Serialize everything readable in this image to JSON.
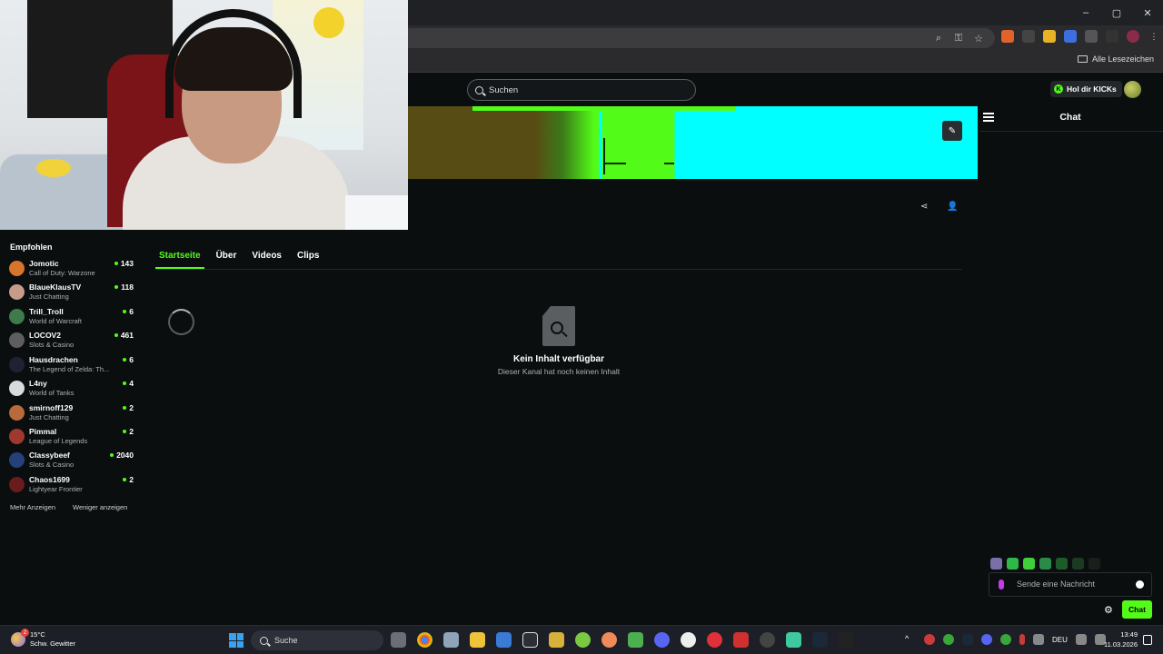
{
  "browser": {
    "window_controls": {
      "minimize": "–",
      "maximize": "▢",
      "close": "✕"
    },
    "bookmarks": {
      "all_label": "Alle Lesezeichen"
    }
  },
  "header": {
    "search_placeholder": "Suchen",
    "kicks_button": "Hol dir KICKs"
  },
  "chat": {
    "title": "Chat",
    "input_placeholder": "Sende eine Nachricht",
    "send_button": "Chat"
  },
  "sidebar": {
    "title": "Empfohlen",
    "items": [
      {
        "name": "Jomotic",
        "category": "Call of Duty: Warzone",
        "viewers": "143",
        "avatar_color": "#d8742b"
      },
      {
        "name": "BlaueKlausTV",
        "category": "Just Chatting",
        "viewers": "118",
        "avatar_color": "#c79b8a"
      },
      {
        "name": "Trill_Troll",
        "category": "World of Warcraft",
        "viewers": "6",
        "avatar_color": "#3f7b4a"
      },
      {
        "name": "LOCOV2",
        "category": "Slots & Casino",
        "viewers": "461",
        "avatar_color": "#5e5e62"
      },
      {
        "name": "Hausdrachen",
        "category": "The Legend of Zelda: Th...",
        "viewers": "6",
        "avatar_color": "#1f2233"
      },
      {
        "name": "L4ny",
        "category": "World of Tanks",
        "viewers": "4",
        "avatar_color": "#d9dadd"
      },
      {
        "name": "smirnoff129",
        "category": "Just Chatting",
        "viewers": "2",
        "avatar_color": "#b86a3c"
      },
      {
        "name": "Pimmal",
        "category": "League of Legends",
        "viewers": "2",
        "avatar_color": "#a0382f"
      },
      {
        "name": "Classybeef",
        "category": "Slots & Casino",
        "viewers": "2040",
        "avatar_color": "#26407a"
      },
      {
        "name": "Chaos1699",
        "category": "Lightyear Frontier",
        "viewers": "2",
        "avatar_color": "#6a1b1b"
      }
    ],
    "show_more": "Mehr Anzeigen",
    "show_less": "Weniger anzeigen"
  },
  "tabs": [
    {
      "label": "Startseite",
      "active": true
    },
    {
      "label": "Über",
      "active": false
    },
    {
      "label": "Videos",
      "active": false
    },
    {
      "label": "Clips",
      "active": false
    }
  ],
  "empty_state": {
    "title": "Kein Inhalt verfügbar",
    "subtitle": "Dieser Kanal hat noch keinen Inhalt"
  },
  "taskbar": {
    "weather_temp": "15°C",
    "weather_desc": "Schw. Gewitter",
    "weather_badge": "2",
    "search_label": "Suche",
    "language": "DEU",
    "time": "13:49",
    "date": "11.03.2026"
  },
  "colors": {
    "accent": "#53fc18",
    "background": "#0b0e0f",
    "banner_cyan": "#00ffff",
    "banner_olive": "#584c15"
  }
}
